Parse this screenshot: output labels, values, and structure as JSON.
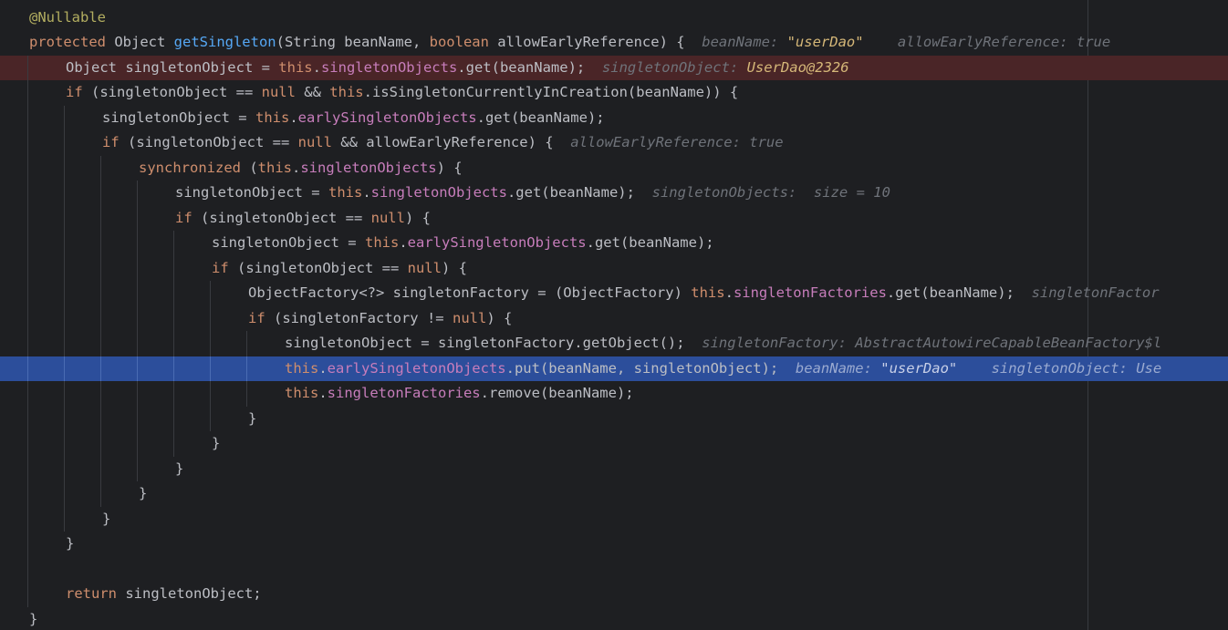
{
  "theme": {
    "background": "#1e1f22",
    "keyword": "#cf8e6d",
    "field": "#c77dbb",
    "method": "#56a8f5",
    "annotation": "#b3ae60",
    "inline_hint": "#6f737a",
    "breakpoint_line": "#4a2527",
    "execution_line": "#2c4e9b"
  },
  "lines": [
    {
      "indent": 0,
      "tokens": [
        {
          "t": "@Nullable",
          "c": "ann"
        }
      ]
    },
    {
      "indent": 0,
      "tokens": [
        {
          "t": "protected",
          "c": "kw"
        },
        {
          "t": " Object ",
          "c": "plain"
        },
        {
          "t": "getSingleton",
          "c": "fn"
        },
        {
          "t": "(String beanName, ",
          "c": "plain"
        },
        {
          "t": "boolean",
          "c": "kw"
        },
        {
          "t": " allowEarlyReference) {",
          "c": "plain"
        },
        {
          "t": "  beanName: ",
          "c": "hint"
        },
        {
          "t": "\"userDao\"",
          "c": "hint-str"
        },
        {
          "t": "    allowEarlyReference: true",
          "c": "hint"
        }
      ]
    },
    {
      "indent": 1,
      "highlight": "breakpoint",
      "tokens": [
        {
          "t": "Object singletonObject = ",
          "c": "plain"
        },
        {
          "t": "this",
          "c": "kw"
        },
        {
          "t": ".",
          "c": "plain"
        },
        {
          "t": "singletonObjects",
          "c": "fld"
        },
        {
          "t": ".get(beanName);",
          "c": "plain"
        },
        {
          "t": "  singletonObject: ",
          "c": "hint"
        },
        {
          "t": "UserDao@2326",
          "c": "hint-str"
        }
      ]
    },
    {
      "indent": 1,
      "tokens": [
        {
          "t": "if",
          "c": "kw"
        },
        {
          "t": " (singletonObject == ",
          "c": "plain"
        },
        {
          "t": "null",
          "c": "kw"
        },
        {
          "t": " && ",
          "c": "plain"
        },
        {
          "t": "this",
          "c": "kw"
        },
        {
          "t": ".isSingletonCurrentlyInCreation(beanName)) {",
          "c": "plain"
        }
      ]
    },
    {
      "indent": 2,
      "tokens": [
        {
          "t": "singletonObject = ",
          "c": "plain"
        },
        {
          "t": "this",
          "c": "kw"
        },
        {
          "t": ".",
          "c": "plain"
        },
        {
          "t": "earlySingletonObjects",
          "c": "fld"
        },
        {
          "t": ".get(beanName);",
          "c": "plain"
        }
      ]
    },
    {
      "indent": 2,
      "tokens": [
        {
          "t": "if",
          "c": "kw"
        },
        {
          "t": " (singletonObject == ",
          "c": "plain"
        },
        {
          "t": "null",
          "c": "kw"
        },
        {
          "t": " && allowEarlyReference) {",
          "c": "plain"
        },
        {
          "t": "  allowEarlyReference: true",
          "c": "hint"
        }
      ]
    },
    {
      "indent": 3,
      "tokens": [
        {
          "t": "synchronized",
          "c": "kw"
        },
        {
          "t": " (",
          "c": "plain"
        },
        {
          "t": "this",
          "c": "kw"
        },
        {
          "t": ".",
          "c": "plain"
        },
        {
          "t": "singletonObjects",
          "c": "fld"
        },
        {
          "t": ") {",
          "c": "plain"
        }
      ]
    },
    {
      "indent": 4,
      "tokens": [
        {
          "t": "singletonObject = ",
          "c": "plain"
        },
        {
          "t": "this",
          "c": "kw"
        },
        {
          "t": ".",
          "c": "plain"
        },
        {
          "t": "singletonObjects",
          "c": "fld"
        },
        {
          "t": ".get(beanName);",
          "c": "plain"
        },
        {
          "t": "  singletonObjects:  size = 10",
          "c": "hint"
        }
      ]
    },
    {
      "indent": 4,
      "tokens": [
        {
          "t": "if",
          "c": "kw"
        },
        {
          "t": " (singletonObject == ",
          "c": "plain"
        },
        {
          "t": "null",
          "c": "kw"
        },
        {
          "t": ") {",
          "c": "plain"
        }
      ]
    },
    {
      "indent": 5,
      "tokens": [
        {
          "t": "singletonObject = ",
          "c": "plain"
        },
        {
          "t": "this",
          "c": "kw"
        },
        {
          "t": ".",
          "c": "plain"
        },
        {
          "t": "earlySingletonObjects",
          "c": "fld"
        },
        {
          "t": ".get(beanName);",
          "c": "plain"
        }
      ]
    },
    {
      "indent": 5,
      "tokens": [
        {
          "t": "if",
          "c": "kw"
        },
        {
          "t": " (singletonObject == ",
          "c": "plain"
        },
        {
          "t": "null",
          "c": "kw"
        },
        {
          "t": ") {",
          "c": "plain"
        }
      ]
    },
    {
      "indent": 6,
      "tokens": [
        {
          "t": "ObjectFactory<?> singletonFactory = (ObjectFactory) ",
          "c": "plain"
        },
        {
          "t": "this",
          "c": "kw"
        },
        {
          "t": ".",
          "c": "plain"
        },
        {
          "t": "singletonFactories",
          "c": "fld"
        },
        {
          "t": ".get(beanName);",
          "c": "plain"
        },
        {
          "t": "  singletonFactor",
          "c": "hint"
        }
      ]
    },
    {
      "indent": 6,
      "tokens": [
        {
          "t": "if",
          "c": "kw"
        },
        {
          "t": " (singletonFactory != ",
          "c": "plain"
        },
        {
          "t": "null",
          "c": "kw"
        },
        {
          "t": ") {",
          "c": "plain"
        }
      ]
    },
    {
      "indent": 7,
      "tokens": [
        {
          "t": "singletonObject = singletonFactory.getObject();",
          "c": "plain"
        },
        {
          "t": "  singletonFactory: AbstractAutowireCapableBeanFactory$l",
          "c": "hint"
        }
      ]
    },
    {
      "indent": 7,
      "highlight": "execution",
      "tokens": [
        {
          "t": "this",
          "c": "kw"
        },
        {
          "t": ".",
          "c": "plain"
        },
        {
          "t": "earlySingletonObjects",
          "c": "fld"
        },
        {
          "t": ".put(beanName, singletonObject);",
          "c": "plain"
        },
        {
          "t": "  beanName: ",
          "c": "hint"
        },
        {
          "t": "\"userDao\"",
          "c": "hint-str"
        },
        {
          "t": "    singletonObject: Use",
          "c": "hint"
        }
      ]
    },
    {
      "indent": 7,
      "tokens": [
        {
          "t": "this",
          "c": "kw"
        },
        {
          "t": ".",
          "c": "plain"
        },
        {
          "t": "singletonFactories",
          "c": "fld"
        },
        {
          "t": ".remove(beanName);",
          "c": "plain"
        }
      ]
    },
    {
      "indent": 6,
      "tokens": [
        {
          "t": "}",
          "c": "plain"
        }
      ]
    },
    {
      "indent": 5,
      "tokens": [
        {
          "t": "}",
          "c": "plain"
        }
      ]
    },
    {
      "indent": 4,
      "tokens": [
        {
          "t": "}",
          "c": "plain"
        }
      ]
    },
    {
      "indent": 3,
      "tokens": [
        {
          "t": "}",
          "c": "plain"
        }
      ]
    },
    {
      "indent": 2,
      "tokens": [
        {
          "t": "}",
          "c": "plain"
        }
      ]
    },
    {
      "indent": 1,
      "tokens": [
        {
          "t": "}",
          "c": "plain"
        }
      ]
    },
    {
      "indent": 1,
      "tokens": []
    },
    {
      "indent": 1,
      "tokens": [
        {
          "t": "return",
          "c": "kw"
        },
        {
          "t": " singletonObject;",
          "c": "plain"
        }
      ]
    },
    {
      "indent": 0,
      "tokens": [
        {
          "t": "}",
          "c": "plain"
        }
      ]
    }
  ]
}
